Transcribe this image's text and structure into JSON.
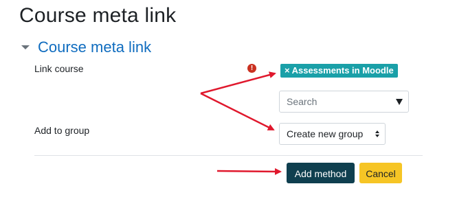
{
  "page": {
    "title": "Course meta link"
  },
  "section": {
    "title": "Course meta link"
  },
  "form": {
    "link_course": {
      "label": "Link course",
      "required_icon": "exclamation-circle-icon",
      "selected_tag": "Assessments in Moodle",
      "remove_glyph": "×",
      "search_placeholder": "Search"
    },
    "add_to_group": {
      "label": "Add to group",
      "selected_value": "Create new group"
    }
  },
  "buttons": {
    "add_method": "Add method",
    "cancel": "Cancel"
  },
  "colors": {
    "title": "#1d2125",
    "section_link": "#0f6cbf",
    "tag": "#1aa0a8",
    "required": "#ca3120",
    "primary_button": "#0f3f4f",
    "cancel_button": "#f6c525",
    "annotation_arrow": "#e0182d"
  }
}
